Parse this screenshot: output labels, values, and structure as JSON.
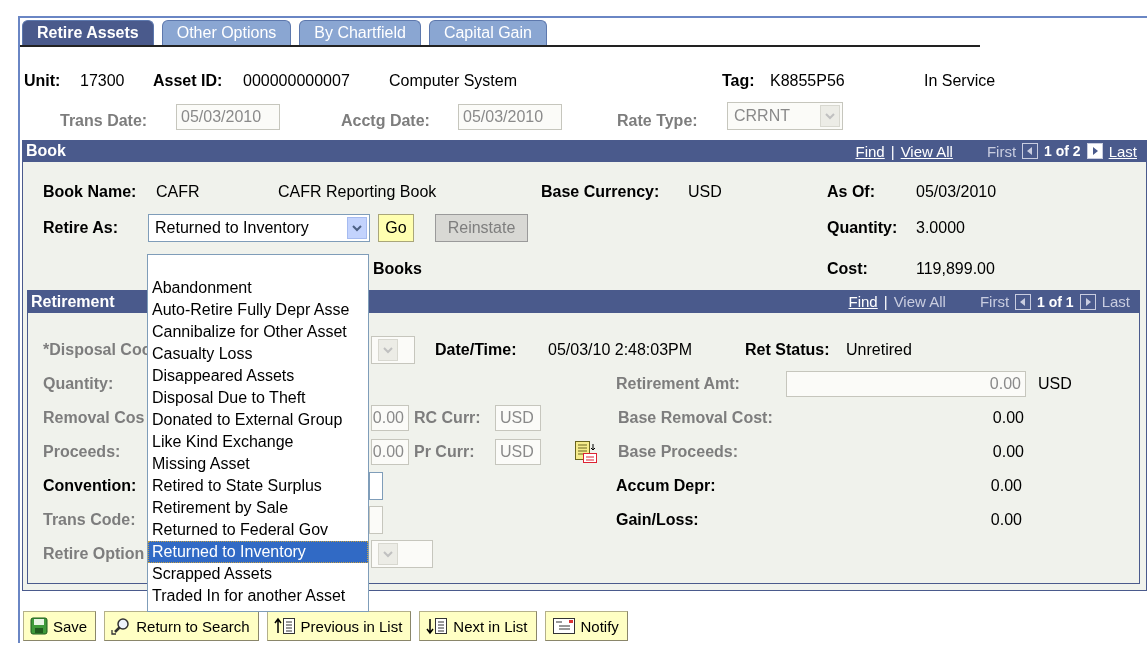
{
  "tabs": [
    {
      "label": "Retire Assets",
      "selected": true
    },
    {
      "label": "Other Options",
      "selected": false
    },
    {
      "label": "By Chartfield",
      "selected": false
    },
    {
      "label": "Capital Gain",
      "selected": false
    }
  ],
  "header": {
    "unit_label": "Unit:",
    "unit": "17300",
    "asset_id_label": "Asset ID:",
    "asset_id": "000000000007",
    "description": "Computer System",
    "tag_label": "Tag:",
    "tag": "K8855P56",
    "status": "In Service"
  },
  "dates": {
    "trans_date": {
      "label": "Trans Date:",
      "value": "05/03/2010",
      "disabled": true
    },
    "acctg_date": {
      "label": "Acctg Date:",
      "value": "05/03/2010",
      "disabled": true
    },
    "rate_type": {
      "label": "Rate Type:",
      "value": "CRRNT",
      "disabled": true
    }
  },
  "book": {
    "title": "Book",
    "nav": {
      "find": "Find",
      "separator": "|",
      "view_all": "View All",
      "view_all_enabled": true,
      "first": "First",
      "first_enabled": false,
      "count": "1 of 2",
      "prev_enabled": false,
      "next_enabled": true,
      "last": "Last",
      "last_enabled": true
    },
    "book_name_label": "Book Name:",
    "book_name": "CAFR",
    "book_description": "CAFR Reporting Book",
    "base_currency_label": "Base Currency:",
    "base_currency": "USD",
    "as_of_label": "As Of:",
    "as_of": "05/03/2010",
    "retire_as": {
      "label": "Retire As:",
      "value": "Returned to Inventory",
      "expanded": true
    },
    "go_button": "Go",
    "reinstate_button": {
      "label": "Reinstate",
      "disabled": true
    },
    "quantity_label": "Quantity:",
    "quantity": "3.0000",
    "books_label": "Books",
    "cost_label": "Cost:",
    "cost": "119,899.00"
  },
  "retirement": {
    "title": "Retirement",
    "nav": {
      "find": "Find",
      "separator": "|",
      "view_all": "View All",
      "view_all_enabled": false,
      "first": "First",
      "first_enabled": false,
      "count": "1 of 1",
      "prev_enabled": false,
      "next_enabled": false,
      "last": "Last",
      "last_enabled": false
    },
    "disposal_code": {
      "label": "*Disposal Coc",
      "disabled": true
    },
    "datetime_label": "Date/Time:",
    "datetime": "05/03/10  2:48:03PM",
    "ret_status_label": "Ret Status:",
    "ret_status": "Unretired",
    "quantity": {
      "label": "Quantity:",
      "disabled": true
    },
    "retirement_amt": {
      "label": "Retirement Amt:",
      "value": "0.00",
      "disabled": true
    },
    "retirement_amt_currency": "USD",
    "removal_cost": {
      "label": "Removal Cos",
      "value": "0.00",
      "disabled": true
    },
    "rc_curr": {
      "label": "RC Curr:",
      "value": "USD",
      "disabled": true
    },
    "base_removal_cost": {
      "label": "Base Removal Cost:",
      "value": "0.00",
      "disabled": true
    },
    "proceeds": {
      "label": "Proceeds:",
      "value": "0.00",
      "disabled": true
    },
    "pr_curr": {
      "label": "Pr Curr:",
      "value": "USD",
      "disabled": true
    },
    "base_proceeds": {
      "label": "Base Proceeds:",
      "value": "0.00",
      "disabled": true
    },
    "convention": {
      "label": "Convention:",
      "disabled": false
    },
    "accum_depr": {
      "label": "Accum Depr:",
      "value": "0.00",
      "disabled": false
    },
    "trans_code": {
      "label": "Trans Code:",
      "disabled": true
    },
    "gain_loss": {
      "label": "Gain/Loss:",
      "value": "0.00",
      "disabled": false
    },
    "retire_option": {
      "label": "Retire Option",
      "disabled": true
    }
  },
  "dropdown": {
    "options": [
      {
        "label": "Abandonment",
        "selected": false
      },
      {
        "label": "Auto-Retire Fully Depr Asse",
        "selected": false
      },
      {
        "label": "Cannibalize for Other Asset",
        "selected": false
      },
      {
        "label": "Casualty Loss",
        "selected": false
      },
      {
        "label": "Disappeared Assets",
        "selected": false
      },
      {
        "label": "Disposal Due to Theft",
        "selected": false
      },
      {
        "label": "Donated to External Group",
        "selected": false
      },
      {
        "label": "Like Kind Exchange",
        "selected": false
      },
      {
        "label": "Missing Asset",
        "selected": false
      },
      {
        "label": "Retired to State Surplus",
        "selected": false
      },
      {
        "label": "Retirement by Sale",
        "selected": false
      },
      {
        "label": "Returned to Federal Gov",
        "selected": false
      },
      {
        "label": "Returned to Inventory",
        "selected": true
      },
      {
        "label": "Scrapped Assets",
        "selected": false
      },
      {
        "label": "Traded In for another Asset",
        "selected": false
      }
    ]
  },
  "buttons": [
    {
      "label": "Save",
      "kind": "save"
    },
    {
      "label": "Return to Search",
      "kind": "search"
    },
    {
      "label": "Previous in List",
      "kind": "previous"
    },
    {
      "label": "Next in List",
      "kind": "next"
    },
    {
      "label": "Notify",
      "kind": "notify"
    }
  ]
}
